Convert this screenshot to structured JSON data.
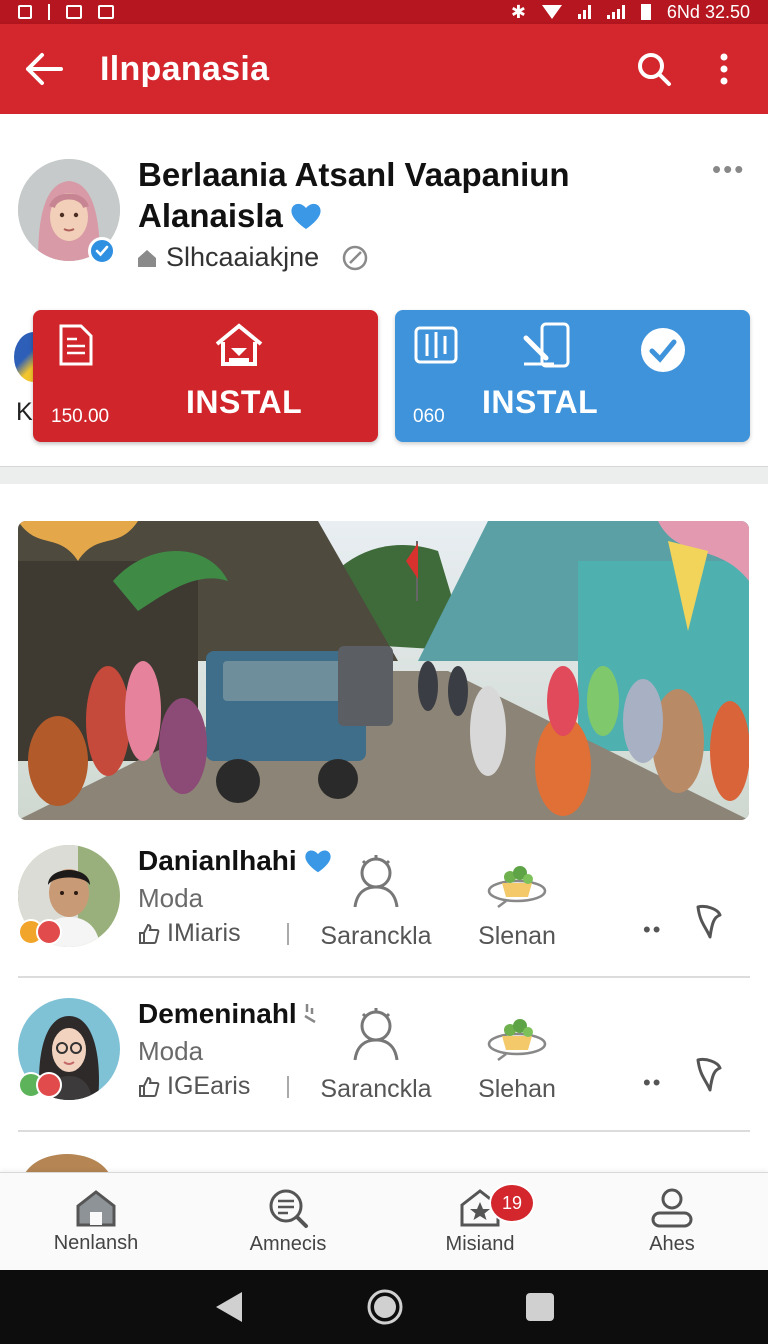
{
  "status_bar": {
    "time": "6Nd 32.50"
  },
  "app_bar": {
    "title": "Ilnpanasia"
  },
  "profile": {
    "name_line1": "Berlaania Atsanl Vaapaniun",
    "name_line2": "Alanaisla",
    "subtitle": "Slhcaaiakjne",
    "peek_letter": "K"
  },
  "tiles": [
    {
      "label": "INSTAL",
      "count": "150.00",
      "color": "#cf252b"
    },
    {
      "label": "INSTAL",
      "count": "060",
      "color": "#3e93da"
    }
  ],
  "list": [
    {
      "name": "Danianlhahi",
      "role": "Moda",
      "likes": "IMiaris",
      "action1": "Saranckla",
      "action2": "Slenan"
    },
    {
      "name": "Demeninahl",
      "role": "Moda",
      "likes": "IGEaris",
      "action1": "Saranckla",
      "action2": "Slehan"
    }
  ],
  "bottom_nav": [
    {
      "label": "Nenlansh",
      "icon": "home-icon"
    },
    {
      "label": "Amnecis",
      "icon": "search-list-icon"
    },
    {
      "label": "Misiand",
      "icon": "star-house-icon",
      "badge": "19"
    },
    {
      "label": "Ahes",
      "icon": "profile-icon"
    }
  ],
  "colors": {
    "primary": "#d3262d",
    "accent_blue": "#3e93da",
    "verified": "#2f8fe0"
  }
}
